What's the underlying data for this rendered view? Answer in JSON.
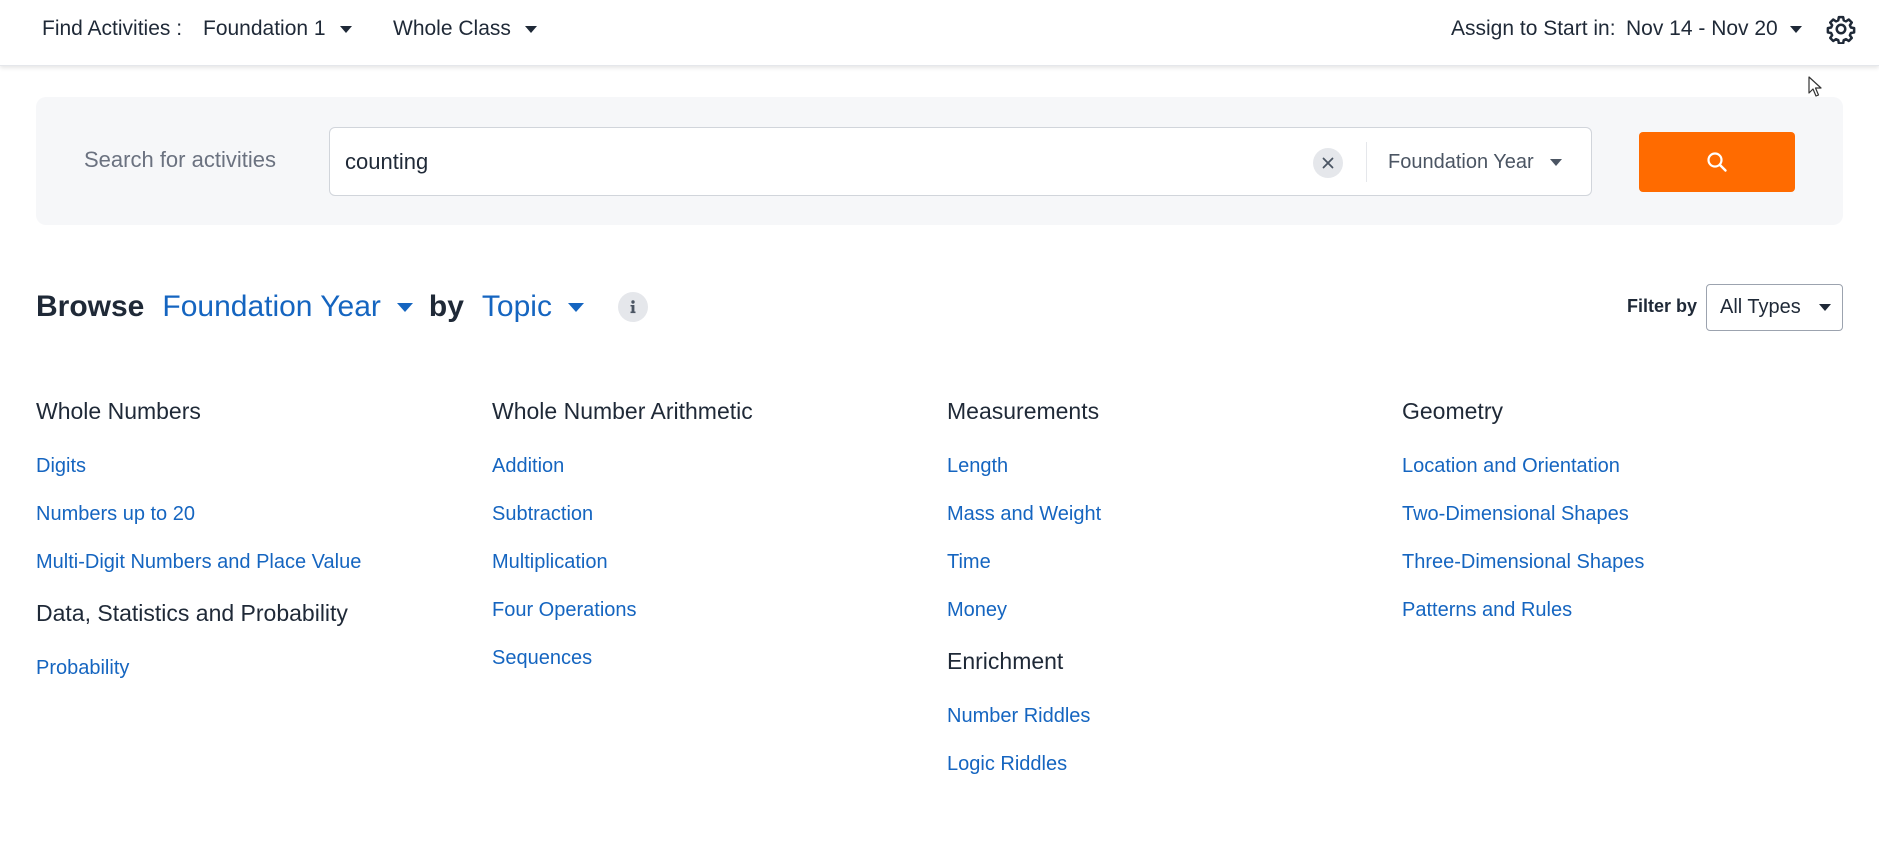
{
  "topbar": {
    "find_label": "Find Activities :",
    "grade_value": "Foundation 1",
    "class_value": "Whole Class",
    "assign_label": "Assign to Start in:",
    "date_value": "Nov 14 - Nov 20"
  },
  "search": {
    "label": "Search for activities",
    "query": "counting",
    "year_value": "Foundation Year"
  },
  "browse": {
    "browse_word": "Browse",
    "year_value": "Foundation Year",
    "by_word": "by",
    "topic_value": "Topic",
    "filter_label": "Filter by",
    "filter_value": "All Types"
  },
  "columns": [
    {
      "groups": [
        {
          "title": "Whole Numbers",
          "items": [
            "Digits",
            "Numbers up to 20",
            "Multi-Digit Numbers and Place Value"
          ]
        },
        {
          "title": "Data, Statistics and Probability",
          "items": [
            "Probability"
          ]
        }
      ]
    },
    {
      "groups": [
        {
          "title": "Whole Number Arithmetic",
          "items": [
            "Addition",
            "Subtraction",
            "Multiplication",
            "Four Operations",
            "Sequences"
          ]
        }
      ]
    },
    {
      "groups": [
        {
          "title": "Measurements",
          "items": [
            "Length",
            "Mass and Weight",
            "Time",
            "Money"
          ]
        },
        {
          "title": "Enrichment",
          "items": [
            "Number Riddles",
            "Logic Riddles"
          ]
        }
      ]
    },
    {
      "groups": [
        {
          "title": "Geometry",
          "items": [
            "Location and Orientation",
            "Two-Dimensional Shapes",
            "Three-Dimensional Shapes",
            "Patterns and Rules"
          ]
        }
      ]
    }
  ],
  "icons": {
    "gear": "gear-icon",
    "search": "search-icon",
    "clear": "close-icon",
    "info": "info-icon"
  },
  "colors": {
    "accent": "#ff6b00",
    "link": "#1565c0",
    "panel": "#f6f7f9"
  }
}
